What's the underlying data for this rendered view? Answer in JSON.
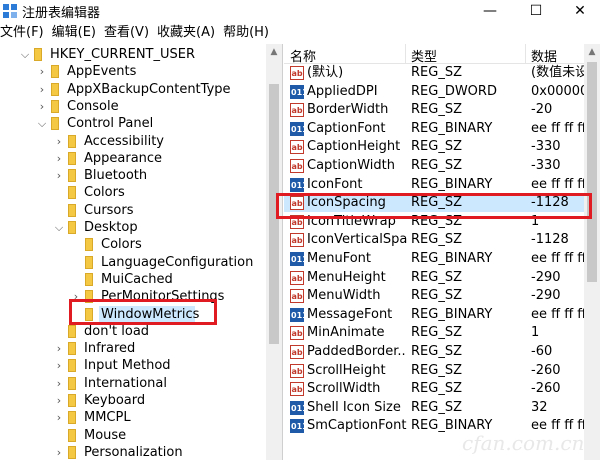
{
  "window": {
    "title": "注册表编辑器",
    "controls": {
      "minimize": "—",
      "maximize": "☐",
      "close": "✕"
    }
  },
  "menu": [
    "文件(F)",
    "编辑(E)",
    "查看(V)",
    "收藏夹(A)",
    "帮助(H)"
  ],
  "tree": [
    {
      "label": "HKEY_CURRENT_USER",
      "chevron": "v"
    },
    {
      "label": "AppEvents",
      "chevron": ">"
    },
    {
      "label": "AppXBackupContentType",
      "chevron": ">"
    },
    {
      "label": "Console",
      "chevron": ">"
    },
    {
      "label": "Control Panel",
      "chevron": "v"
    },
    {
      "label": "Accessibility",
      "chevron": ">"
    },
    {
      "label": "Appearance",
      "chevron": ">"
    },
    {
      "label": "Bluetooth",
      "chevron": ">"
    },
    {
      "label": "Colors",
      "chevron": ""
    },
    {
      "label": "Cursors",
      "chevron": ""
    },
    {
      "label": "Desktop",
      "chevron": "v"
    },
    {
      "label": "Colors",
      "chevron": ""
    },
    {
      "label": "LanguageConfiguration",
      "chevron": ""
    },
    {
      "label": "MuiCached",
      "chevron": ""
    },
    {
      "label": "PerMonitorSettings",
      "chevron": ">"
    },
    {
      "label": "WindowMetrics",
      "chevron": "",
      "selected": true
    },
    {
      "label": "don't load",
      "chevron": ""
    },
    {
      "label": "Infrared",
      "chevron": ">"
    },
    {
      "label": "Input Method",
      "chevron": ">"
    },
    {
      "label": "International",
      "chevron": ">"
    },
    {
      "label": "Keyboard",
      "chevron": ">"
    },
    {
      "label": "MMCPL",
      "chevron": ">"
    },
    {
      "label": "Mouse",
      "chevron": ""
    },
    {
      "label": "Personalization",
      "chevron": ">"
    }
  ],
  "list": {
    "columns": [
      "名称",
      "类型",
      "数据"
    ],
    "rows": [
      {
        "icon": "ab",
        "name": "(默认)",
        "type": "REG_SZ",
        "data": "(数值未设置"
      },
      {
        "icon": "bin",
        "name": "AppliedDPI",
        "type": "REG_DWORD",
        "data": "0x000000"
      },
      {
        "icon": "ab",
        "name": "BorderWidth",
        "type": "REG_SZ",
        "data": "-20"
      },
      {
        "icon": "bin",
        "name": "CaptionFont",
        "type": "REG_BINARY",
        "data": "ee ff ff ff 0"
      },
      {
        "icon": "ab",
        "name": "CaptionHeight",
        "type": "REG_SZ",
        "data": "-330"
      },
      {
        "icon": "ab",
        "name": "CaptionWidth",
        "type": "REG_SZ",
        "data": "-330"
      },
      {
        "icon": "bin",
        "name": "IconFont",
        "type": "REG_BINARY",
        "data": "ee ff ff ff 0"
      },
      {
        "icon": "ab",
        "name": "IconSpacing",
        "type": "REG_SZ",
        "data": "-1128",
        "selected": true
      },
      {
        "icon": "ab",
        "name": "IconTitleWrap",
        "type": "REG_SZ",
        "data": "1"
      },
      {
        "icon": "ab",
        "name": "IconVerticalSpa...",
        "type": "REG_SZ",
        "data": "-1128"
      },
      {
        "icon": "bin",
        "name": "MenuFont",
        "type": "REG_BINARY",
        "data": "ee ff ff ff 0"
      },
      {
        "icon": "ab",
        "name": "MenuHeight",
        "type": "REG_SZ",
        "data": "-290"
      },
      {
        "icon": "ab",
        "name": "MenuWidth",
        "type": "REG_SZ",
        "data": "-290"
      },
      {
        "icon": "bin",
        "name": "MessageFont",
        "type": "REG_BINARY",
        "data": "ee ff ff ff 0"
      },
      {
        "icon": "ab",
        "name": "MinAnimate",
        "type": "REG_SZ",
        "data": "1"
      },
      {
        "icon": "ab",
        "name": "PaddedBorder...",
        "type": "REG_SZ",
        "data": "-60"
      },
      {
        "icon": "ab",
        "name": "ScrollHeight",
        "type": "REG_SZ",
        "data": "-260"
      },
      {
        "icon": "ab",
        "name": "ScrollWidth",
        "type": "REG_SZ",
        "data": "-260"
      },
      {
        "icon": "bin",
        "name": "Shell Icon Size",
        "type": "REG_SZ",
        "data": "32"
      },
      {
        "icon": "bin",
        "name": "SmCaptionFont",
        "type": "REG_BINARY",
        "data": "ee ff ff ff 0"
      }
    ]
  },
  "icon_labels": {
    "ab": "ab",
    "bin": "011"
  },
  "watermark": "cfan.com.cn",
  "colors": {
    "highlight_box": "#e11b22",
    "selection": "#cce8ff",
    "folder": "#f4c842"
  }
}
